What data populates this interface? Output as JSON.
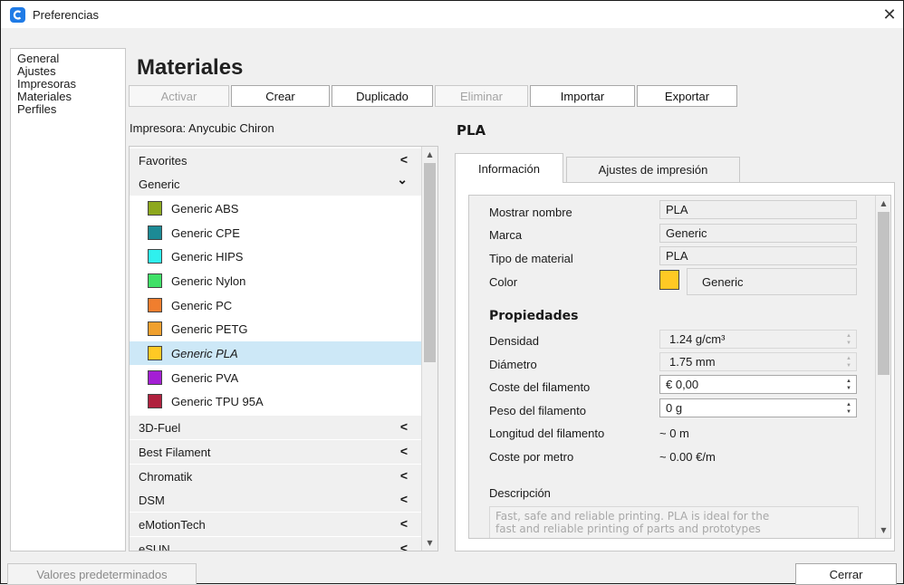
{
  "window": {
    "title": "Preferencias",
    "close_glyph": "✕",
    "icon": "app-logo-icon",
    "accent": "#1f7be6"
  },
  "sidebar": {
    "items": [
      {
        "label": "General"
      },
      {
        "label": "Ajustes"
      },
      {
        "label": "Impresoras"
      },
      {
        "label": "Materiales"
      },
      {
        "label": "Perfiles"
      }
    ]
  },
  "page": {
    "heading": "Materiales",
    "printer_label": "Impresora: Anycubic Chiron",
    "material_name": "PLA"
  },
  "toolbar": {
    "activar": "Activar",
    "crear": "Crear",
    "duplicado": "Duplicado",
    "eliminar": "Eliminar",
    "importar": "Importar",
    "exportar": "Exportar"
  },
  "materials_list": {
    "favorites": {
      "label": "Favorites",
      "arrow": "<"
    },
    "generic": {
      "label": "Generic",
      "arrow": "⌄"
    },
    "generic_items": [
      {
        "label": "Generic ABS",
        "color": "#8da81e"
      },
      {
        "label": "Generic CPE",
        "color": "#1c8a95"
      },
      {
        "label": "Generic HIPS",
        "color": "#2ff0ee"
      },
      {
        "label": "Generic Nylon",
        "color": "#3fe067"
      },
      {
        "label": "Generic PC",
        "color": "#f07e2e"
      },
      {
        "label": "Generic PETG",
        "color": "#f0a02e"
      },
      {
        "label": "Generic PLA",
        "color": "#ffc924",
        "selected": true
      },
      {
        "label": "Generic PVA",
        "color": "#a41fd4"
      },
      {
        "label": "Generic TPU 95A",
        "color": "#b0213e"
      }
    ],
    "brands": [
      {
        "label": "3D-Fuel",
        "arrow": "<"
      },
      {
        "label": "Best Filament",
        "arrow": "<"
      },
      {
        "label": "Chromatik",
        "arrow": "<"
      },
      {
        "label": "DSM",
        "arrow": "<"
      },
      {
        "label": "eMotionTech",
        "arrow": "<"
      },
      {
        "label": "eSUN",
        "arrow": "<"
      }
    ]
  },
  "tabs": {
    "informacion": "Información",
    "ajustes": "Ajustes de impresión"
  },
  "info": {
    "mostrar_nombre": {
      "label": "Mostrar nombre",
      "value": "PLA"
    },
    "marca": {
      "label": "Marca",
      "value": "Generic"
    },
    "tipo": {
      "label": "Tipo de material",
      "value": "PLA"
    },
    "color": {
      "label": "Color",
      "value": "Generic",
      "swatch": "#ffc924"
    },
    "propiedades": "Propiedades",
    "densidad": {
      "label": "Densidad",
      "value": "1.24 g/cm³"
    },
    "diametro": {
      "label": "Diámetro",
      "value": "1.75 mm"
    },
    "coste": {
      "label": "Coste del filamento",
      "value": "€ 0,00"
    },
    "peso": {
      "label": "Peso del filamento",
      "value": "0 g"
    },
    "longitud": {
      "label": "Longitud del filamento",
      "value": "~ 0 m"
    },
    "coste_metro": {
      "label": "Coste por metro",
      "value": "~ 0.00 €/m"
    },
    "descripcion_label": "Descripción",
    "descripcion_line1": "Fast, safe and reliable printing. PLA is ideal for the",
    "descripcion_line2": "fast and reliable printing of parts and prototypes"
  },
  "footer": {
    "reset": "Valores predeterminados",
    "close": "Cerrar"
  }
}
